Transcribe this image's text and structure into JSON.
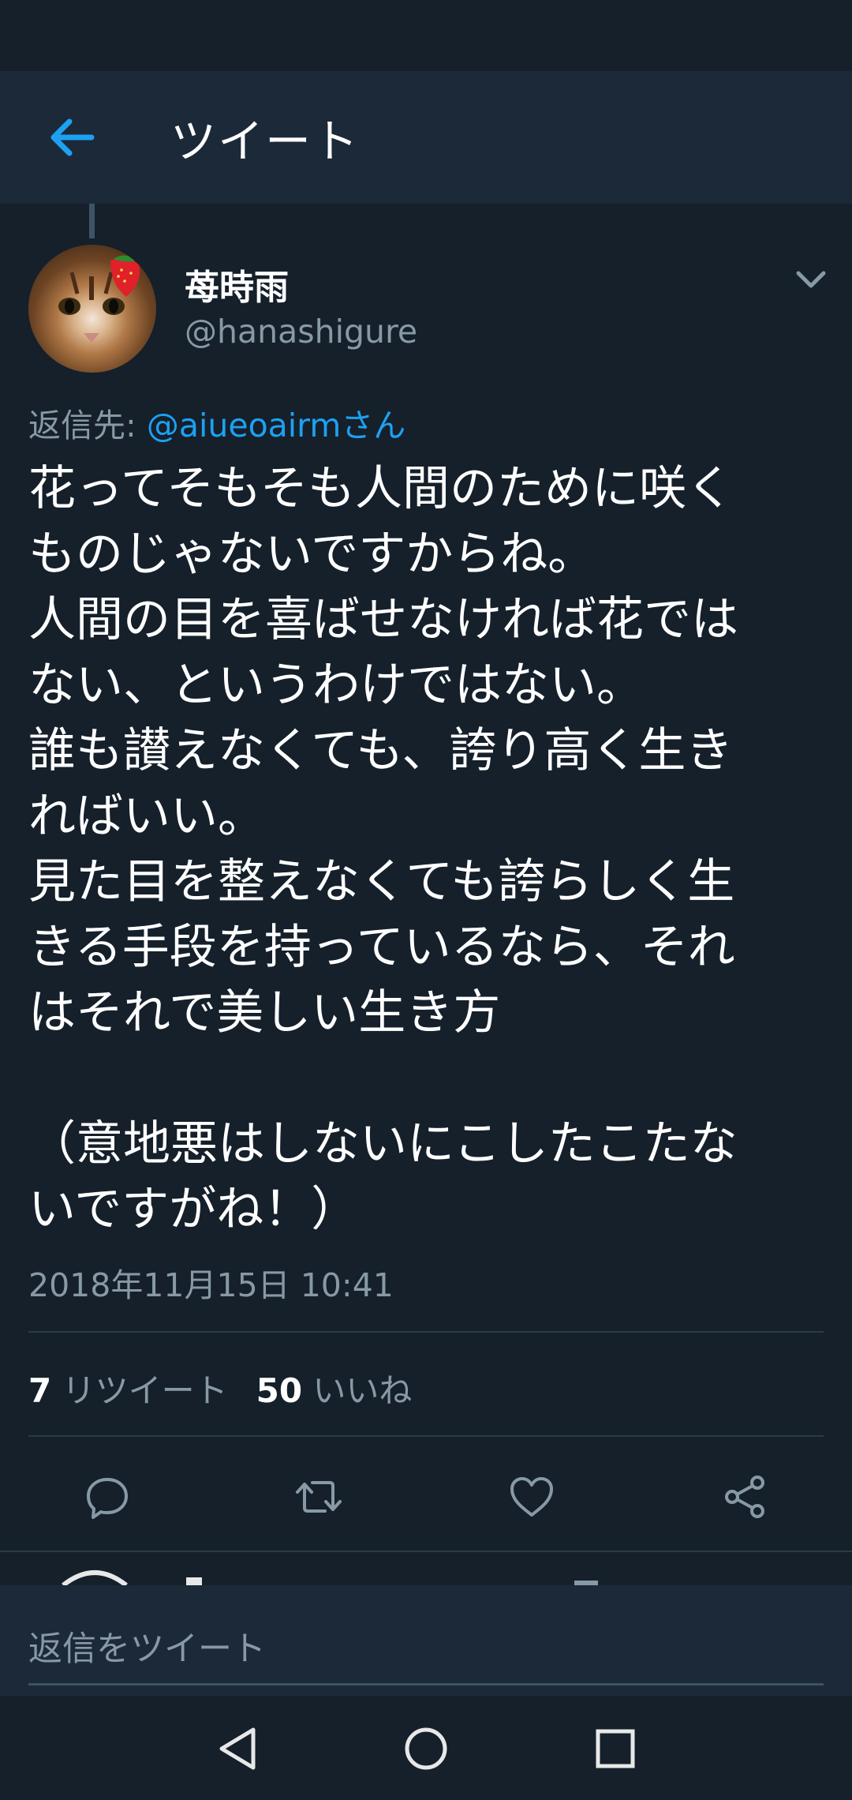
{
  "appbar": {
    "title": "ツイート"
  },
  "tweet": {
    "author_name": "苺時雨",
    "author_handle": "@hanashigure",
    "reply_prefix": "返信先: ",
    "reply_mention": "@aiueoairmさん",
    "text": "花ってそもそも人間のために咲く\nものじゃないですからね。\n人間の目を喜ばせなければ花では\nない、というわけではない。\n誰も讃えなくても、誇り高く生き\nればいい。\n見た目を整えなくても誇らしく生\nきる手段を持っているなら、それ\nはそれで美しい生き方\n\n（意地悪はしないにこしたこたな\nいですがね！）",
    "timestamp": "2018年11月15日 10:41"
  },
  "stats": {
    "retweets_count": "7",
    "retweets_label": " リツイート",
    "likes_count": "50",
    "likes_label": " いいね"
  },
  "actions": {
    "icons": [
      "reply-icon",
      "retweet-icon",
      "like-icon",
      "share-icon"
    ]
  },
  "reply_bar": {
    "placeholder": "返信をツイート"
  },
  "colors": {
    "background": "#15202b",
    "bar": "#1c2938",
    "accent": "#1da1f2",
    "secondary_text": "#8899a6"
  }
}
